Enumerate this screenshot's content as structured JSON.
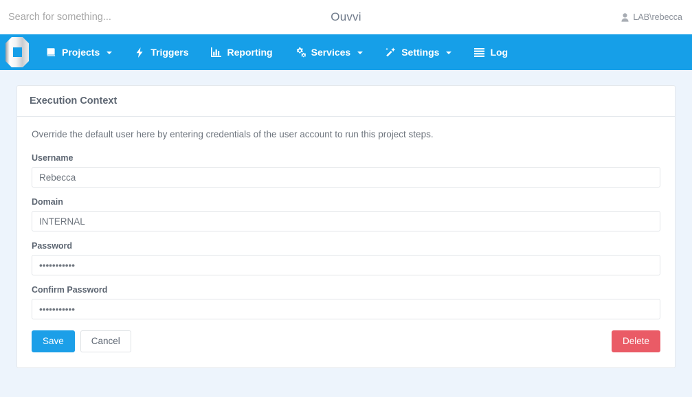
{
  "topbar": {
    "search_placeholder": "Search for something...",
    "search_value": "",
    "app_title": "Ouvvi",
    "user_label": "LAB\\rebecca",
    "user_icon": "user-icon"
  },
  "nav": {
    "brand_icon": "ouvvi-logo-icon",
    "items": [
      {
        "label": "Projects",
        "icon": "book-icon",
        "caret": true
      },
      {
        "label": "Triggers",
        "icon": "bolt-icon",
        "caret": false
      },
      {
        "label": "Reporting",
        "icon": "bar-chart-icon",
        "caret": false
      },
      {
        "label": "Services",
        "icon": "cogs-icon",
        "caret": true
      },
      {
        "label": "Settings",
        "icon": "magic-wand-icon",
        "caret": true
      },
      {
        "label": "Log",
        "icon": "list-icon",
        "caret": false
      }
    ]
  },
  "panel": {
    "title": "Execution Context",
    "help_text": "Override the default user here by entering credentials of the user account to run this project steps.",
    "fields": [
      {
        "label": "Username",
        "value": "Rebecca",
        "type": "text"
      },
      {
        "label": "Domain",
        "value": "INTERNAL",
        "type": "text"
      },
      {
        "label": "Password",
        "value": "•••••••••••",
        "type": "password"
      },
      {
        "label": "Confirm Password",
        "value": "•••••••••••",
        "type": "password"
      }
    ],
    "buttons": {
      "save": "Save",
      "cancel": "Cancel",
      "delete": "Delete"
    }
  },
  "colors": {
    "nav_blue": "#169fe8",
    "primary": "#1c9fe8",
    "danger": "#ea5b66",
    "page_bg": "#edf4fc",
    "text_muted": "#6d747d"
  }
}
